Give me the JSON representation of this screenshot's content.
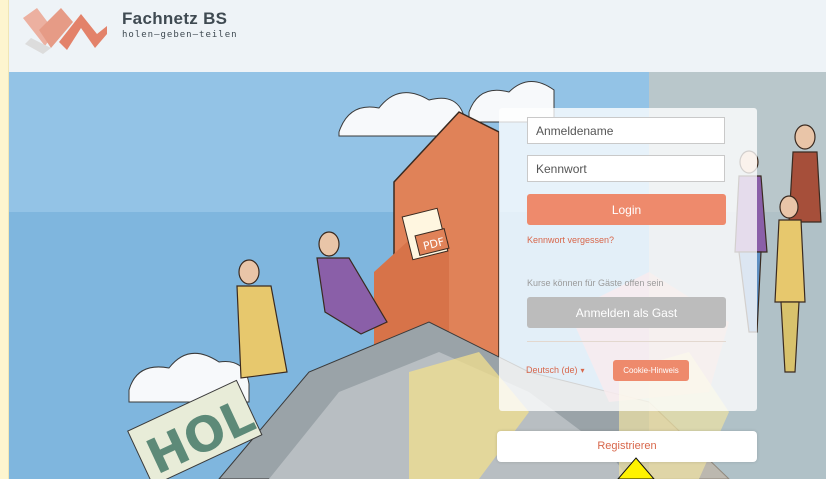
{
  "brand": {
    "name": "Fachnetz BS",
    "tagline": "holen–geben–teilen",
    "colors": {
      "accent": "#ee8a6c",
      "link": "#d8674b",
      "disabled": "#bcbcbc"
    }
  },
  "login": {
    "username_placeholder": "Anmeldename",
    "password_placeholder": "Kennwort",
    "login_label": "Login",
    "forgot_label": "Kennwort vergessen?",
    "guest_note": "Kurse können für Gäste offen sein",
    "guest_label": "Anmelden als Gast",
    "language_label": "Deutsch (de)",
    "cookie_label": "Cookie-Hinweis"
  },
  "register": {
    "label": "Registrieren"
  },
  "illustration": {
    "badge_text": "PDF",
    "sign_text": "HOL"
  }
}
